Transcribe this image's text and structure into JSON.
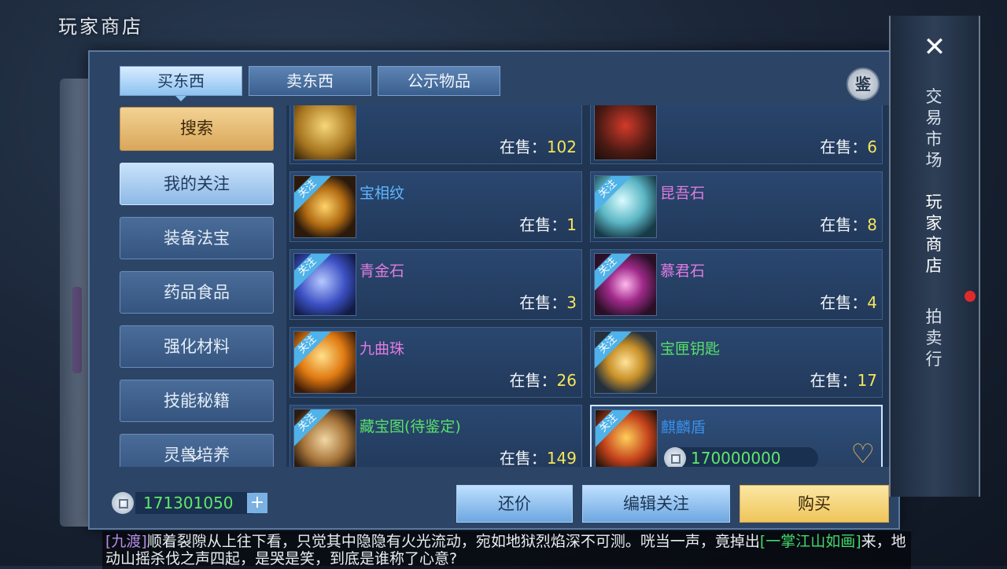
{
  "window_title": "玩家商店",
  "tabs": [
    {
      "label": "买东西",
      "active": true
    },
    {
      "label": "卖东西",
      "active": false
    },
    {
      "label": "公示物品",
      "active": false
    }
  ],
  "appraise_label": "鉴",
  "sidebar": {
    "search_label": "搜索",
    "items": [
      {
        "label": "我的关注",
        "active": true
      },
      {
        "label": "装备法宝"
      },
      {
        "label": "药品食品"
      },
      {
        "label": "强化材料"
      },
      {
        "label": "技能秘籍"
      },
      {
        "label": "灵兽培养"
      }
    ]
  },
  "sale_prefix": "在售：",
  "follow_badge": "关注",
  "items": [
    {
      "name": "",
      "count": "102",
      "color": "#58e06a",
      "icon": "scroll-gold-icon"
    },
    {
      "name": "",
      "count": "6",
      "color": "#5fb6ff",
      "icon": "red-armor-icon"
    },
    {
      "name": "宝相纹",
      "count": "1",
      "color": "#5fb6ff",
      "icon": "gold-rune-icon"
    },
    {
      "name": "昆吾石",
      "count": "8",
      "color": "#e07be0",
      "icon": "jade-orb-icon"
    },
    {
      "name": "青金石",
      "count": "3",
      "color": "#e07be0",
      "icon": "blue-gem-icon"
    },
    {
      "name": "慕君石",
      "count": "4",
      "color": "#e07be0",
      "icon": "purple-crystal-icon"
    },
    {
      "name": "九曲珠",
      "count": "26",
      "color": "#e07be0",
      "icon": "fire-orb-icon"
    },
    {
      "name": "宝匣钥匙",
      "count": "17",
      "color": "#58e06a",
      "icon": "golden-key-icon"
    },
    {
      "name": "藏宝图(待鉴定)",
      "count": "149",
      "color": "#58e06a",
      "icon": "treasure-map-icon"
    },
    {
      "name": "麒麟盾",
      "price": "170000000",
      "color": "#3a8fe8",
      "icon": "qilin-shield-icon",
      "selected": true
    }
  ],
  "balance": "171301050",
  "actions": {
    "bargain": "还价",
    "edit_follow": "编辑关注",
    "buy": "购买"
  },
  "right_tabs": [
    {
      "label": "交易市场"
    },
    {
      "label": "玩家商店",
      "active": true
    },
    {
      "label": "拍卖行"
    }
  ],
  "chat": {
    "speaker": "[九渡]",
    "text1": "顺着裂隙从上往下看，只觉其中隐隐有火光流动，宛如地狱烈焰深不可测。咣当一声，竟掉出",
    "link": "[一掌江山如画]",
    "text2": "来，地动山摇杀伐之声四起，是哭是笑，到底是谁称了心意?"
  }
}
